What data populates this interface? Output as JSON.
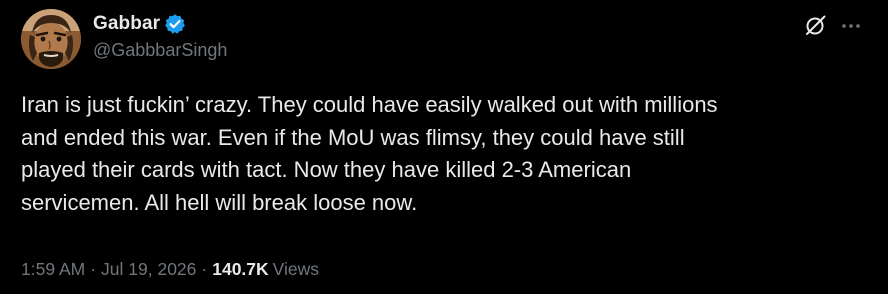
{
  "author": {
    "display_name": "Gabbar",
    "handle": "@GabbbarSingh",
    "verified": true,
    "verified_color": "#1d9bf0"
  },
  "actions": {
    "grok_icon": "grok-icon",
    "more_icon": "more-dots-icon"
  },
  "tweet": {
    "text_lines": [
      "Iran is just fuckin’ crazy. They could have easily walked out with millions",
      "and ended this war. Even if the MoU was flimsy, they could have still",
      "played their cards with tact. Now they have killed 2-3 American",
      "servicemen. All hell will break loose now."
    ]
  },
  "meta": {
    "time": "1:59 AM",
    "separator": "·",
    "date": "Jul 19, 2026",
    "views_count": "140.7K",
    "views_label": "Views"
  },
  "colors": {
    "background": "#000000",
    "text_primary": "#e7e9ea",
    "text_secondary": "#71767b"
  }
}
